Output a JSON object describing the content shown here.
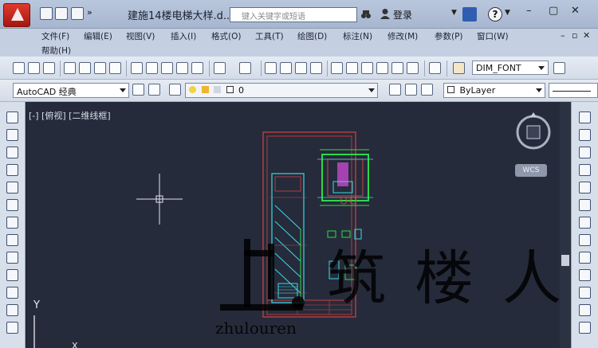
{
  "window": {
    "title": "建施14楼电梯大样.d...",
    "search_placeholder": "键入关键字或短语",
    "login_label": "登录",
    "help_label": "?"
  },
  "menu": {
    "row1": [
      "文件(F)",
      "编辑(E)",
      "视图(V)",
      "插入(I)",
      "格式(O)",
      "工具(T)",
      "绘图(D)",
      "标注(N)",
      "修改(M)",
      "参数(P)",
      "窗口(W)"
    ],
    "row2": [
      "帮助(H)"
    ]
  },
  "toolbar": {
    "font_style": "DIM_FONT",
    "workspace": "AutoCAD 经典",
    "layer": "0",
    "linetype": "ByLayer"
  },
  "viewport": {
    "label": "[-] [俯视] [二维线框]",
    "wcs_label": "WCS",
    "y_axis": "Y",
    "x_axis": "X"
  },
  "watermark": {
    "chinese": "筑楼人",
    "english": "zhulouren"
  },
  "colors": {
    "canvas": "#252b3a",
    "frame": "#d84040",
    "cyan": "#3cd8e8",
    "green": "#2fd84a",
    "magenta": "#d24ad8"
  }
}
